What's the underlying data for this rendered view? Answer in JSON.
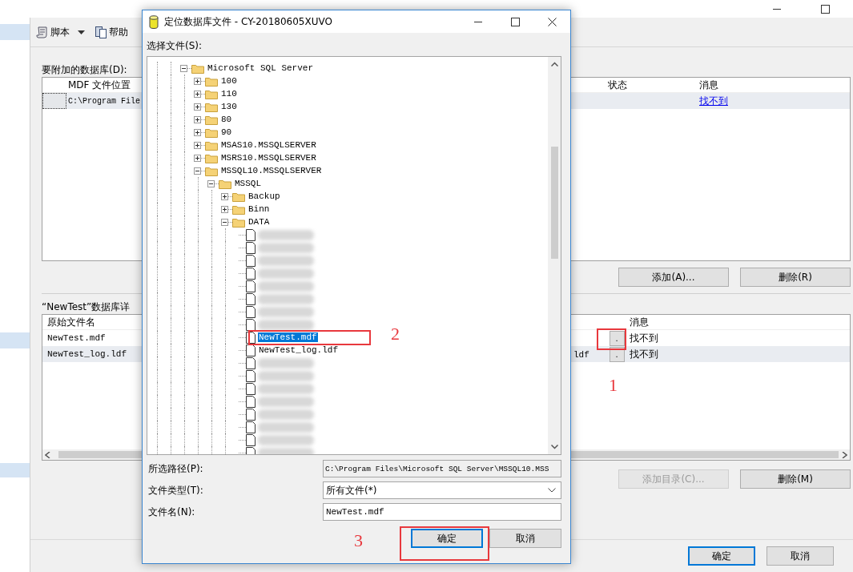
{
  "main_window": {
    "toolbar": [
      {
        "kind": "script",
        "label": "脚本",
        "dropdown": true
      },
      {
        "kind": "help",
        "label": "帮助",
        "dropdown": false
      }
    ],
    "databases_label": "要附加的数据库(D):",
    "databases_table": {
      "columns": [
        "MDF 文件位置",
        "状态",
        "消息"
      ],
      "rows": [
        {
          "location": "C:\\Program File",
          "message": "找不到"
        }
      ]
    },
    "add_button": "添加(A)...",
    "remove_button": "删除(R)",
    "details_label": "“NewTest”数据库详",
    "details_table": {
      "columns": [
        "原始文件名",
        "消息"
      ],
      "rows": [
        {
          "original_name": "NewTest.mdf",
          "browse_button": ".",
          "message": "找不到"
        },
        {
          "original_name": "NewTest_log.ldf",
          "column_3": "ldf",
          "browse_button": ".",
          "message": "找不到"
        }
      ]
    },
    "add_catalog_button": {
      "label": "添加目录(C)...",
      "disabled": true
    },
    "remove_catalog_button": {
      "label": "删除(M)",
      "disabled": false
    },
    "ok_button": "确定",
    "cancel_button": "取消"
  },
  "dialog": {
    "title": "定位数据库文件 - CY-20180605XUVO",
    "tree_label": "选择文件(S):",
    "tree": [
      {
        "kind": "folder",
        "label": "Microsoft SQL Server",
        "expanded": true,
        "children": [
          {
            "kind": "folder",
            "label": "100",
            "expanded": false
          },
          {
            "kind": "folder",
            "label": "110",
            "expanded": false
          },
          {
            "kind": "folder",
            "label": "130",
            "expanded": false
          },
          {
            "kind": "folder",
            "label": "80",
            "expanded": false
          },
          {
            "kind": "folder",
            "label": "90",
            "expanded": false
          },
          {
            "kind": "folder",
            "label": "MSAS10.MSSQLSERVER",
            "expanded": false
          },
          {
            "kind": "folder",
            "label": "MSRS10.MSSQLSERVER",
            "expanded": false
          },
          {
            "kind": "folder",
            "label": "MSSQL10.MSSQLSERVER",
            "expanded": true,
            "children": [
              {
                "kind": "folder",
                "label": "MSSQL",
                "expanded": true,
                "children": [
                  {
                    "kind": "folder",
                    "label": "Backup",
                    "expanded": false
                  },
                  {
                    "kind": "folder",
                    "label": "Binn",
                    "expanded": false
                  },
                  {
                    "kind": "folder",
                    "label": "DATA",
                    "expanded": true,
                    "children": [
                      {
                        "kind": "obscured",
                        "selected": false
                      },
                      {
                        "kind": "obscured",
                        "selected": false
                      },
                      {
                        "kind": "obscured",
                        "selected": false
                      },
                      {
                        "kind": "obscured",
                        "selected": false
                      },
                      {
                        "kind": "obscured",
                        "selected": false
                      },
                      {
                        "kind": "obscured",
                        "selected": false
                      },
                      {
                        "kind": "obscured",
                        "selected": false
                      },
                      {
                        "kind": "obscured",
                        "selected": false
                      },
                      {
                        "kind": "file",
                        "label": "NewTest.mdf",
                        "selected": true
                      },
                      {
                        "kind": "file",
                        "label": "NewTest_log.ldf",
                        "selected": false
                      },
                      {
                        "kind": "obscured",
                        "selected": false
                      },
                      {
                        "kind": "obscured",
                        "selected": false
                      },
                      {
                        "kind": "obscured",
                        "selected": false
                      },
                      {
                        "kind": "obscured",
                        "selected": false
                      },
                      {
                        "kind": "obscured",
                        "selected": false
                      },
                      {
                        "kind": "obscured",
                        "selected": false
                      },
                      {
                        "kind": "obscured",
                        "selected": false
                      },
                      {
                        "kind": "obscured",
                        "selected": false
                      }
                    ]
                  }
                ]
              }
            ]
          }
        ]
      }
    ],
    "fields": [
      {
        "kind": "text",
        "label": "所选路径(P):",
        "value": "C:\\Program Files\\Microsoft SQL Server\\MSSQL10.MSS"
      },
      {
        "kind": "dropdown",
        "label": "文件类型(T):",
        "value": "所有文件(*)"
      },
      {
        "kind": "input",
        "label": "文件名(N):",
        "value": "NewTest.mdf"
      }
    ],
    "ok_button": "确定",
    "cancel_button": "取消"
  },
  "annotations": [
    {
      "label": "1"
    },
    {
      "label": "2"
    },
    {
      "label": "3"
    }
  ]
}
